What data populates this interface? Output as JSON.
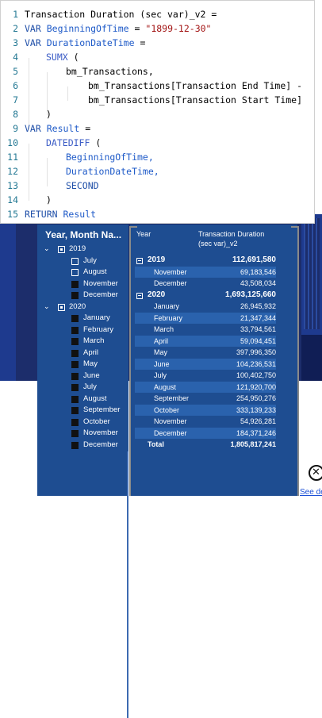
{
  "code": {
    "lines": [
      {
        "n": "1",
        "text": "Transaction Duration (sec var)_v2 ="
      },
      {
        "n": "2",
        "kw": "VAR",
        "var": "BeginningOfTime",
        "eq": "=",
        "str": "\"1899-12-30\""
      },
      {
        "n": "3",
        "kw": "VAR",
        "var": "DurationDateTime",
        "eq": "="
      },
      {
        "n": "4",
        "fn": "SUMX",
        "rest": "("
      },
      {
        "n": "5",
        "text": "bm_Transactions,"
      },
      {
        "n": "6",
        "text": "bm_Transactions[Transaction End Time] -"
      },
      {
        "n": "7",
        "text": "bm_Transactions[Transaction Start Time]"
      },
      {
        "n": "8",
        "text": ")"
      },
      {
        "n": "9",
        "kw": "VAR",
        "var": "Result",
        "eq": "="
      },
      {
        "n": "10",
        "fn": "DATEDIFF",
        "rest": "("
      },
      {
        "n": "11",
        "var": "BeginningOfTime,"
      },
      {
        "n": "12",
        "var": "DurationDateTime,"
      },
      {
        "n": "13",
        "kw": "SECOND"
      },
      {
        "n": "14",
        "text": ")"
      },
      {
        "n": "15",
        "kw": "RETURN",
        "var": "Result"
      }
    ]
  },
  "slicer": {
    "title": "Year, Month Na...",
    "years": [
      {
        "label": "2019",
        "state": "partial",
        "expanded": true,
        "months": [
          {
            "label": "July",
            "checked": false
          },
          {
            "label": "August",
            "checked": false
          },
          {
            "label": "November",
            "checked": true
          },
          {
            "label": "December",
            "checked": true
          }
        ]
      },
      {
        "label": "2020",
        "state": "filled",
        "expanded": true,
        "months": [
          {
            "label": "January",
            "checked": true
          },
          {
            "label": "February",
            "checked": true
          },
          {
            "label": "March",
            "checked": true
          },
          {
            "label": "April",
            "checked": true
          },
          {
            "label": "May",
            "checked": true
          },
          {
            "label": "June",
            "checked": true
          },
          {
            "label": "July",
            "checked": true
          },
          {
            "label": "August",
            "checked": true
          },
          {
            "label": "September",
            "checked": true
          },
          {
            "label": "October",
            "checked": true
          },
          {
            "label": "November",
            "checked": true
          },
          {
            "label": "December",
            "checked": true
          }
        ]
      }
    ]
  },
  "matrix": {
    "col_year": "Year",
    "col_measure_1": "Transaction Duration",
    "col_measure_2": "(sec var)_v2",
    "rows": [
      {
        "type": "group",
        "label": "2019",
        "value": "112,691,580"
      },
      {
        "type": "item",
        "label": "November",
        "value": "69,183,546"
      },
      {
        "type": "item",
        "label": "December",
        "value": "43,508,034"
      },
      {
        "type": "group",
        "label": "2020",
        "value": "1,693,125,660"
      },
      {
        "type": "item",
        "label": "January",
        "value": "26,945,932"
      },
      {
        "type": "item",
        "label": "February",
        "value": "21,347,344"
      },
      {
        "type": "item",
        "label": "March",
        "value": "33,794,561"
      },
      {
        "type": "item",
        "label": "April",
        "value": "59,094,451"
      },
      {
        "type": "item",
        "label": "May",
        "value": "397,996,350"
      },
      {
        "type": "item",
        "label": "June",
        "value": "104,236,531"
      },
      {
        "type": "item",
        "label": "July",
        "value": "100,402,750"
      },
      {
        "type": "item",
        "label": "August",
        "value": "121,920,700"
      },
      {
        "type": "item",
        "label": "September",
        "value": "254,950,276"
      },
      {
        "type": "item",
        "label": "October",
        "value": "333,139,233"
      },
      {
        "type": "item",
        "label": "November",
        "value": "54,926,281"
      },
      {
        "type": "item",
        "label": "December",
        "value": "184,371,246"
      },
      {
        "type": "total",
        "label": "Total",
        "value": "1,805,817,241"
      }
    ]
  },
  "footer": {
    "close_icon": "close-circle-icon",
    "link_text": "See de"
  },
  "colors": {
    "visual_bg": "#1e4d91",
    "page_bg": "#1c2d6b",
    "row_alt": "#2a62ad",
    "code_keyword": "#1f4fa8",
    "code_string": "#a31515"
  }
}
